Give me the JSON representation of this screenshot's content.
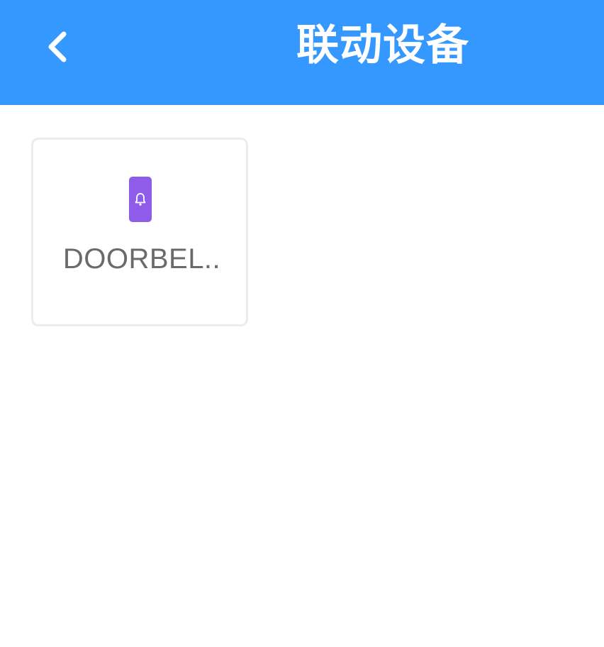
{
  "header": {
    "title": "联动设备",
    "back_icon": "chevron-left-icon",
    "background_color": "#3598fe"
  },
  "devices": [
    {
      "name": "DOORBEL..",
      "icon": "doorbell-icon",
      "icon_color": "#8e5ce8"
    }
  ]
}
